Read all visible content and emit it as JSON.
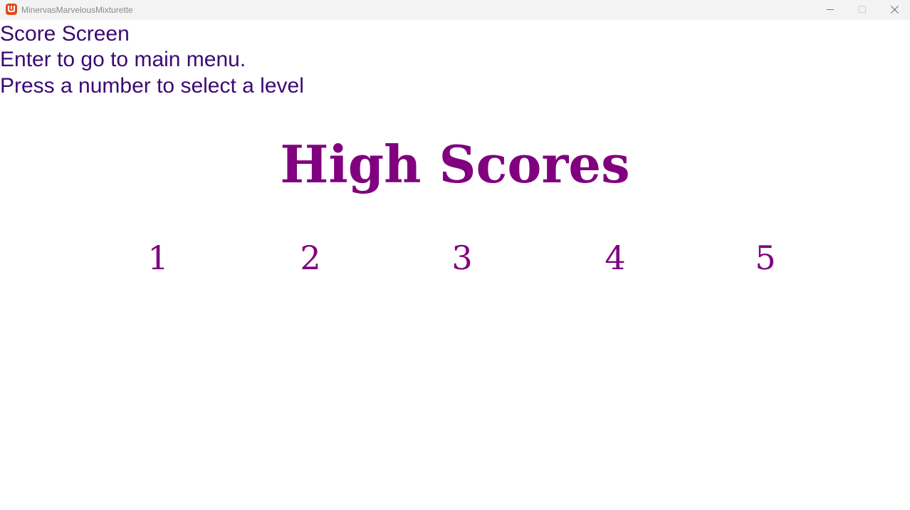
{
  "window": {
    "title": "MinervasMarvelousMixturette",
    "icon": "monogame-icon",
    "controls": [
      "minimize-icon",
      "maximize-icon",
      "close-icon"
    ]
  },
  "screen": {
    "instructions": [
      "Score Screen",
      "Enter to go to main menu.",
      "Press a number to select a level"
    ],
    "heading": "High Scores",
    "levels": [
      "1",
      "2",
      "3",
      "4",
      "5"
    ]
  },
  "colors": {
    "instruction_text": "#3b0a72",
    "heading_text": "#800080",
    "background": "#ffffff",
    "titlebar": "#f3f3f3"
  }
}
